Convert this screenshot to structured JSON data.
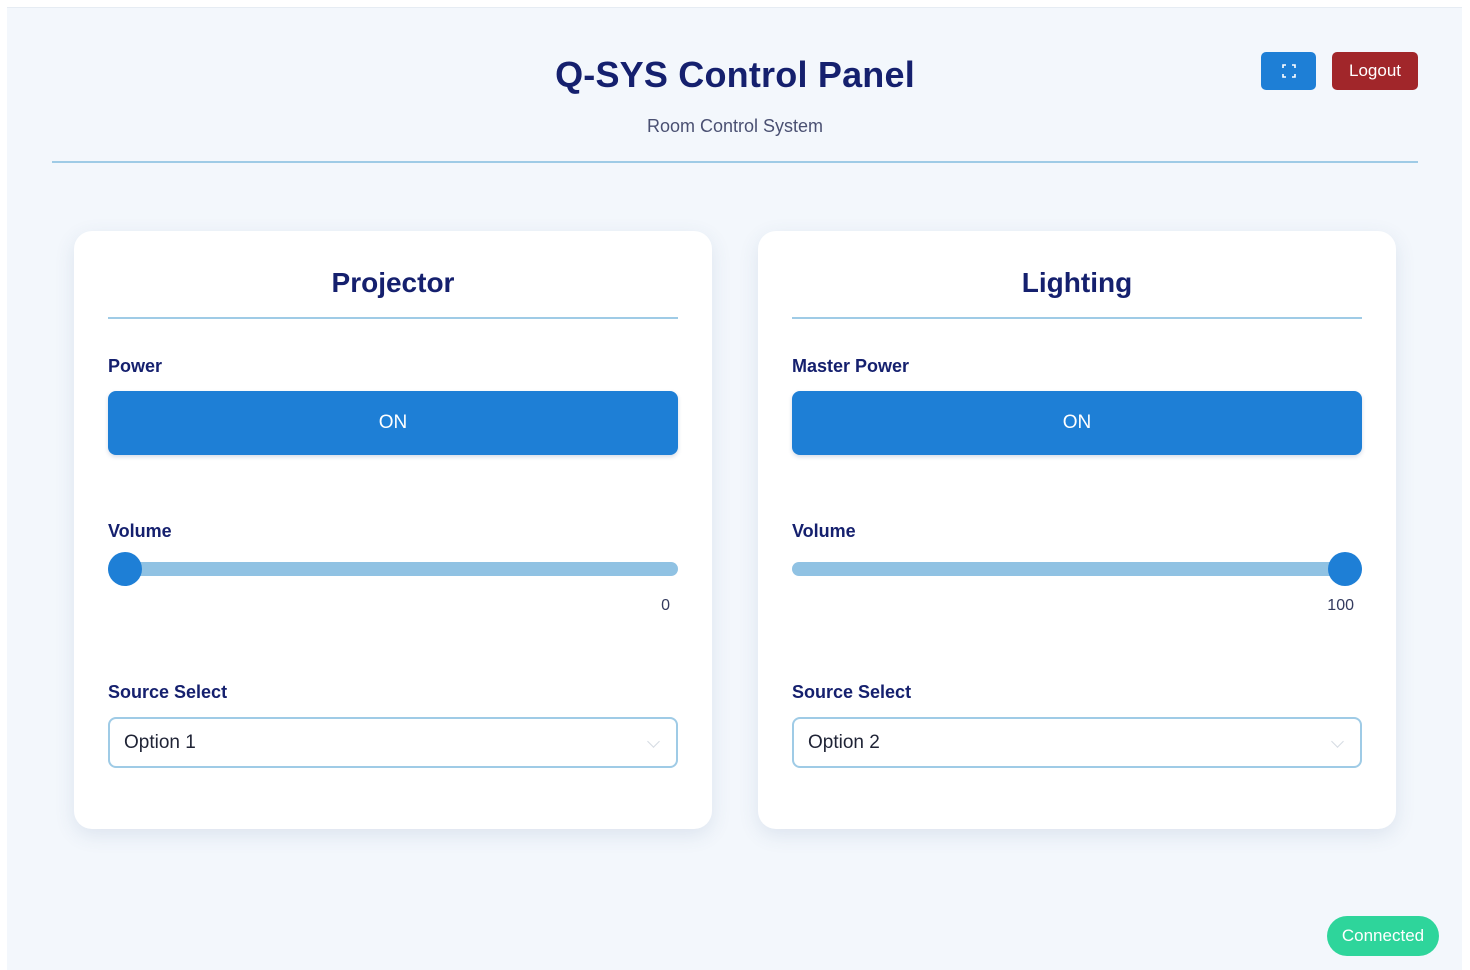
{
  "header": {
    "title": "Q-SYS Control Panel",
    "subtitle": "Room Control System",
    "fullscreen_icon": "fullscreen-icon",
    "logout_label": "Logout"
  },
  "colors": {
    "primary": "#1e7fd6",
    "danger": "#a1262a",
    "success": "#2ed59b",
    "accent_line": "#9fcbe6",
    "title": "#15206e"
  },
  "cards": [
    {
      "title": "Projector",
      "power_label": "Power",
      "power_state": "ON",
      "volume_label": "Volume",
      "volume_value": "0",
      "volume_fraction": 0,
      "source_label": "Source Select",
      "source_value": "Option 1"
    },
    {
      "title": "Lighting",
      "power_label": "Master Power",
      "power_state": "ON",
      "volume_label": "Volume",
      "volume_value": "100",
      "volume_fraction": 1,
      "source_label": "Source Select",
      "source_value": "Option 2"
    }
  ],
  "status": {
    "label": "Connected"
  }
}
